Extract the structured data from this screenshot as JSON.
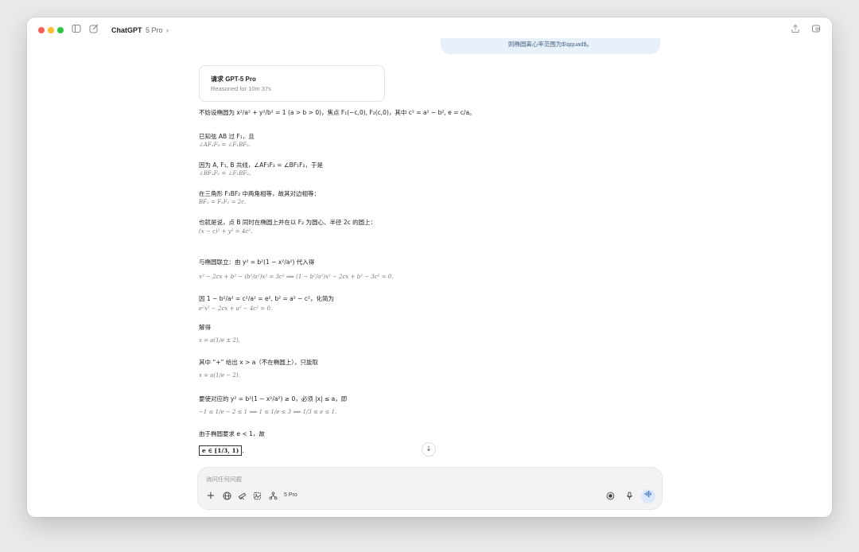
{
  "app": {
    "title": "ChatGPT",
    "model": "5 Pro",
    "chevron": "›"
  },
  "titlebar_icons": {
    "sidebar": "sidebar-toggle-icon",
    "new_chat": "new-chat-icon",
    "share": "share-icon",
    "window": "window-toggle-icon"
  },
  "user_message_tail": "则椭圆离心率范围为$\\qquad$。",
  "reasoning_card": {
    "title": "请求 GPT-5 Pro",
    "subtitle": "Reasoned for 10m 37s"
  },
  "answer": {
    "l1": "不妨设椭圆为 x²/a² + y²/b² = 1 (a > b > 0)，焦点 F₁(−c,0), F₂(c,0)，其中 c² = a² − b², e = c/a。",
    "l2": "已知弦 AB 过 F₁，且",
    "m2": "∠AF₁F₂ = ∠F₁BF₂.",
    "l3": "因为 A, F₁, B 共线，∠AF₁F₂ = ∠BF₁F₂，于是",
    "m3": "∠BF₁F₂ = ∠F₁BF₂,",
    "l4": "在三角形 F₁BF₂ 中两角相等，故其对边相等：",
    "m4": "BF₂ = F₁F₂ = 2c.",
    "l5": "也就是说，点 B 同时在椭圆上并在以 F₂ 为圆心、半径 2c 的圆上：",
    "m5": "(x − c)² + y² = 4c².",
    "l6": "与椭圆联立：由 y² = b²(1 − x²/a²) 代入得",
    "m6": "x² − 2cx + b² − (b²/a²)x² = 3c²  ⟹  (1 − b²/a²)x² − 2cx + b² − 3c² = 0.",
    "l7": "因 1 − b²/a² = c²/a² = e², b² = a² − c²，化简为",
    "m7": "e²x² − 2cx + a² − 4c² = 0.",
    "l8": "解得",
    "m8": "x = a(1/e ± 2).",
    "l9": "其中 “+” 给出 x > a（不在椭圆上），只能取",
    "m9": "x = a(1/e − 2).",
    "l10": "要使对应的 y² = b²(1 − x²/a²) ≥ 0，必须 |x| ≤ a，即",
    "m10": "−1 ≤ 1/e − 2 ≤ 1   ⟺   1 ≤ 1/e ≤ 3   ⟺   1/3 ≤ e ≤ 1.",
    "l11": "由于椭圆要求 e < 1，故",
    "result": "e ∈ [1/3, 1)",
    "result_tail": "."
  },
  "composer": {
    "placeholder": "询问任何问题",
    "model_label": "5 Pro",
    "icons": [
      "plus-icon",
      "globe-icon",
      "telescope-icon",
      "image-icon",
      "connectors-icon"
    ],
    "right_icons": [
      "record-icon",
      "mic-icon",
      "voice-mode-icon"
    ]
  },
  "scroll_down": "↓"
}
